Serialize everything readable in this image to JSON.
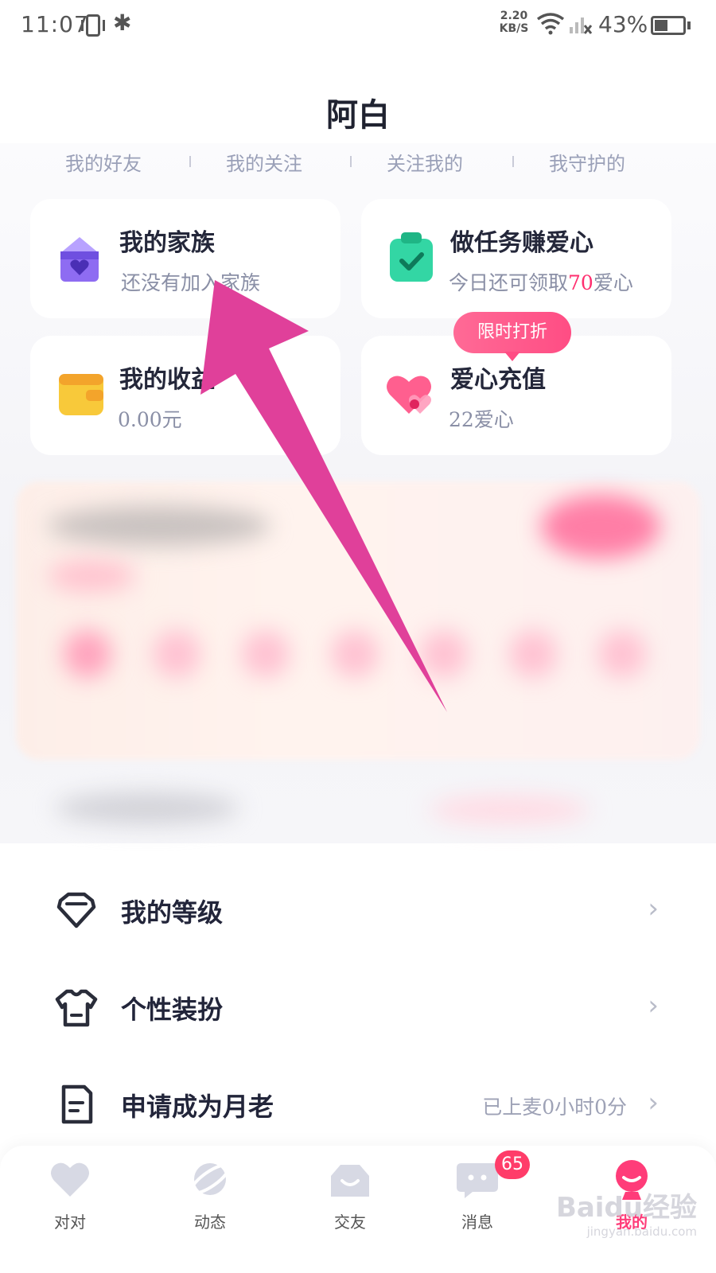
{
  "status_bar": {
    "time": "11:07",
    "net_speed_value": "2.20",
    "net_speed_unit": "KB/S",
    "battery": "43%"
  },
  "header": {
    "title": "阿白"
  },
  "stats": [
    "我的好友",
    "我的关注",
    "关注我的",
    "我守护的"
  ],
  "cards": {
    "family": {
      "title": "我的家族",
      "sub": "还没有加入家族"
    },
    "tasks": {
      "title": "做任务赚爱心",
      "sub_prefix": "今日还可领取",
      "sub_num": "70",
      "sub_suffix": "爱心"
    },
    "income": {
      "title": "我的收益",
      "sub": "0.00元"
    },
    "recharge": {
      "title": "爱心充值",
      "sub": "22爱心",
      "tag": "限时打折"
    }
  },
  "list": {
    "level": {
      "label": "我的等级"
    },
    "dress": {
      "label": "个性装扮"
    },
    "matchmaker": {
      "label": "申请成为月老",
      "extra": "已上麦0小时0分"
    }
  },
  "bottom_nav": {
    "items": [
      {
        "label": "对对",
        "icon": "heart-icon"
      },
      {
        "label": "动态",
        "icon": "planet-icon"
      },
      {
        "label": "交友",
        "icon": "smile-bag-icon"
      },
      {
        "label": "消息",
        "icon": "chat-bubble-icon"
      },
      {
        "label": "我的",
        "icon": "profile-icon"
      }
    ],
    "message_badge": "65",
    "active": "我的"
  },
  "colors": {
    "accent": "#ff3c79",
    "annotation_arrow": "#e0409a",
    "family_icon": "#8e6cf2",
    "task_icon": "#33d6a4",
    "wallet_icon": "#f8c93a"
  },
  "watermark": {
    "line1": "Baidu经验",
    "line2": "jingyan.baidu.com"
  }
}
